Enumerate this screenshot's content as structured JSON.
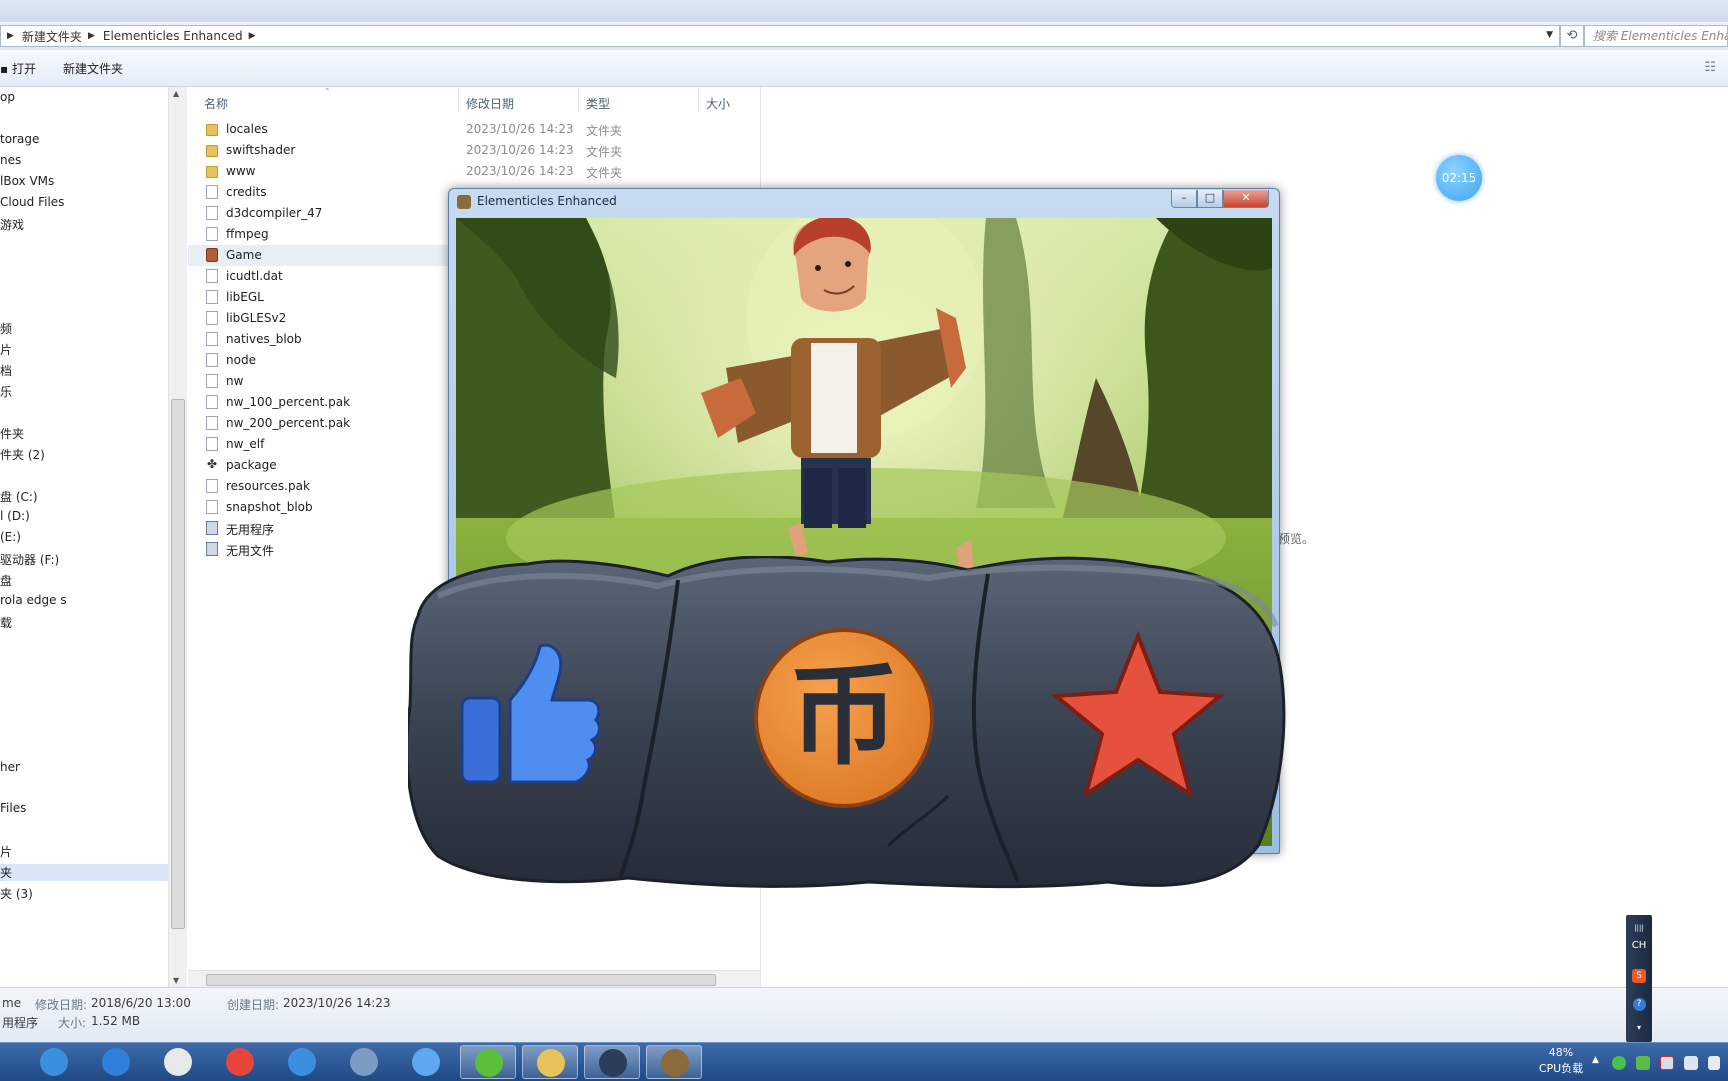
{
  "address": {
    "crumbs": [
      "新建文件夹",
      "Elementicles Enhanced"
    ],
    "search_placeholder": "搜索 Elementicles Enhanced"
  },
  "toolbar": {
    "open_label": "打开",
    "new_folder_label": "新建文件夹"
  },
  "nav": {
    "items": [
      {
        "label": "op"
      },
      {
        "label": "torage"
      },
      {
        "label": "nes"
      },
      {
        "label": "lBox VMs"
      },
      {
        "label": "Cloud Files"
      },
      {
        "label": "游戏"
      },
      {
        "label": "频"
      },
      {
        "label": "片"
      },
      {
        "label": "档"
      },
      {
        "label": "乐"
      },
      {
        "label": "件夹"
      },
      {
        "label": "件夹 (2)"
      },
      {
        "label": "盘 (C:)"
      },
      {
        "label": "l (D:)"
      },
      {
        "label": " (E:)"
      },
      {
        "label": "驱动器 (F:)"
      },
      {
        "label": "盘"
      },
      {
        "label": "rola edge s"
      },
      {
        "label": "载"
      },
      {
        "label": "her"
      },
      {
        "label": " Files"
      },
      {
        "label": "片"
      },
      {
        "label": "夹"
      },
      {
        "label": "夹 (3)"
      }
    ]
  },
  "list": {
    "columns": {
      "name": "名称",
      "date": "修改日期",
      "type": "类型",
      "size": "大小"
    },
    "rows": [
      {
        "name": "locales",
        "date": "2023/10/26 14:23",
        "type": "文件夹",
        "icon": "folder-icon"
      },
      {
        "name": "swiftshader",
        "date": "2023/10/26 14:23",
        "type": "文件夹",
        "icon": "folder-icon"
      },
      {
        "name": "www",
        "date": "2023/10/26 14:23",
        "type": "文件夹",
        "icon": "folder-icon"
      },
      {
        "name": "credits",
        "icon": "file-icon"
      },
      {
        "name": "d3dcompiler_47",
        "icon": "file-icon"
      },
      {
        "name": "ffmpeg",
        "icon": "file-icon"
      },
      {
        "name": "Game",
        "icon": "app-icon"
      },
      {
        "name": "icudtl.dat",
        "icon": "file-icon"
      },
      {
        "name": "libEGL",
        "icon": "file-icon"
      },
      {
        "name": "libGLESv2",
        "icon": "file-icon"
      },
      {
        "name": "natives_blob",
        "icon": "file-icon"
      },
      {
        "name": "node",
        "icon": "file-icon"
      },
      {
        "name": "nw",
        "icon": "file-icon"
      },
      {
        "name": "nw_100_percent.pak",
        "icon": "file-icon"
      },
      {
        "name": "nw_200_percent.pak",
        "icon": "file-icon"
      },
      {
        "name": "nw_elf",
        "icon": "file-icon"
      },
      {
        "name": "package",
        "icon": "gear-icon"
      },
      {
        "name": "resources.pak",
        "icon": "file-icon"
      },
      {
        "name": "snapshot_blob",
        "icon": "file-icon"
      },
      {
        "name": "无用程序",
        "icon": "batch-icon"
      },
      {
        "name": "无用文件",
        "icon": "batch-icon"
      }
    ]
  },
  "preview": {
    "text": "预览。",
    "timer": "02:15"
  },
  "details": {
    "name_fragment": "me",
    "type_fragment": "用程序",
    "modified_label": "修改日期:",
    "modified_value": "2018/6/20 13:00",
    "created_label": "创建日期:",
    "created_value": "2023/10/26 14:23",
    "size_label": "大小:",
    "size_value": "1.52 MB"
  },
  "game_window": {
    "title": "Elementicles Enhanced"
  },
  "overlay": {
    "like": "like-thumb-icon",
    "coin": "coin-icon",
    "favorite": "star-icon",
    "coin_glyph": "币"
  },
  "taskbar": {
    "apps": [
      {
        "icon": "ie-icon",
        "color": "#3b8fe0"
      },
      {
        "icon": "sogou-icon",
        "color": "#2f80d8"
      },
      {
        "icon": "notepad-icon",
        "color": "#e8e8e8"
      },
      {
        "icon": "chrome-icon",
        "color": "#e8453c"
      },
      {
        "icon": "ie2-icon",
        "color": "#3b8fe0"
      },
      {
        "icon": "computer-icon",
        "color": "#7c9bc1"
      },
      {
        "icon": "bird-icon",
        "color": "#5fa8f0"
      },
      {
        "icon": "green-app-icon",
        "color": "#5cbf3a"
      },
      {
        "icon": "explorer-folder-icon",
        "color": "#e8c25b"
      },
      {
        "icon": "cube-icon",
        "color": "#2b3d5a"
      },
      {
        "icon": "game-icon",
        "color": "#8b6a3b"
      }
    ],
    "cpu_percent": "48%",
    "cpu_label": "CPU负载"
  },
  "ime": {
    "mode": "CH"
  },
  "colors": {
    "accent": "#3e6aa8",
    "selection": "#d9e7f6"
  }
}
